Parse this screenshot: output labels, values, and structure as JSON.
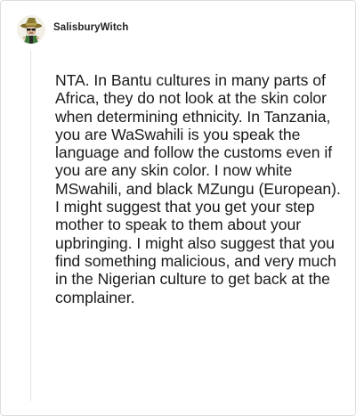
{
  "post": {
    "author": "SalisburyWitch",
    "avatar_icon": "witch-avatar-icon",
    "body": "NTA. In Bantu cultures in many parts of Africa, they do not look at the skin color when determining ethnicity. In Tanzania, you are WaSwahili is you speak the language and follow the customs even if you are any skin color. I now white MSwahili, and black MZungu (European). I might suggest that you get your step mother to speak to them about your upbringing. I might also suggest that you find something malicious, and very much in the Nigerian culture to get back at the complainer."
  }
}
